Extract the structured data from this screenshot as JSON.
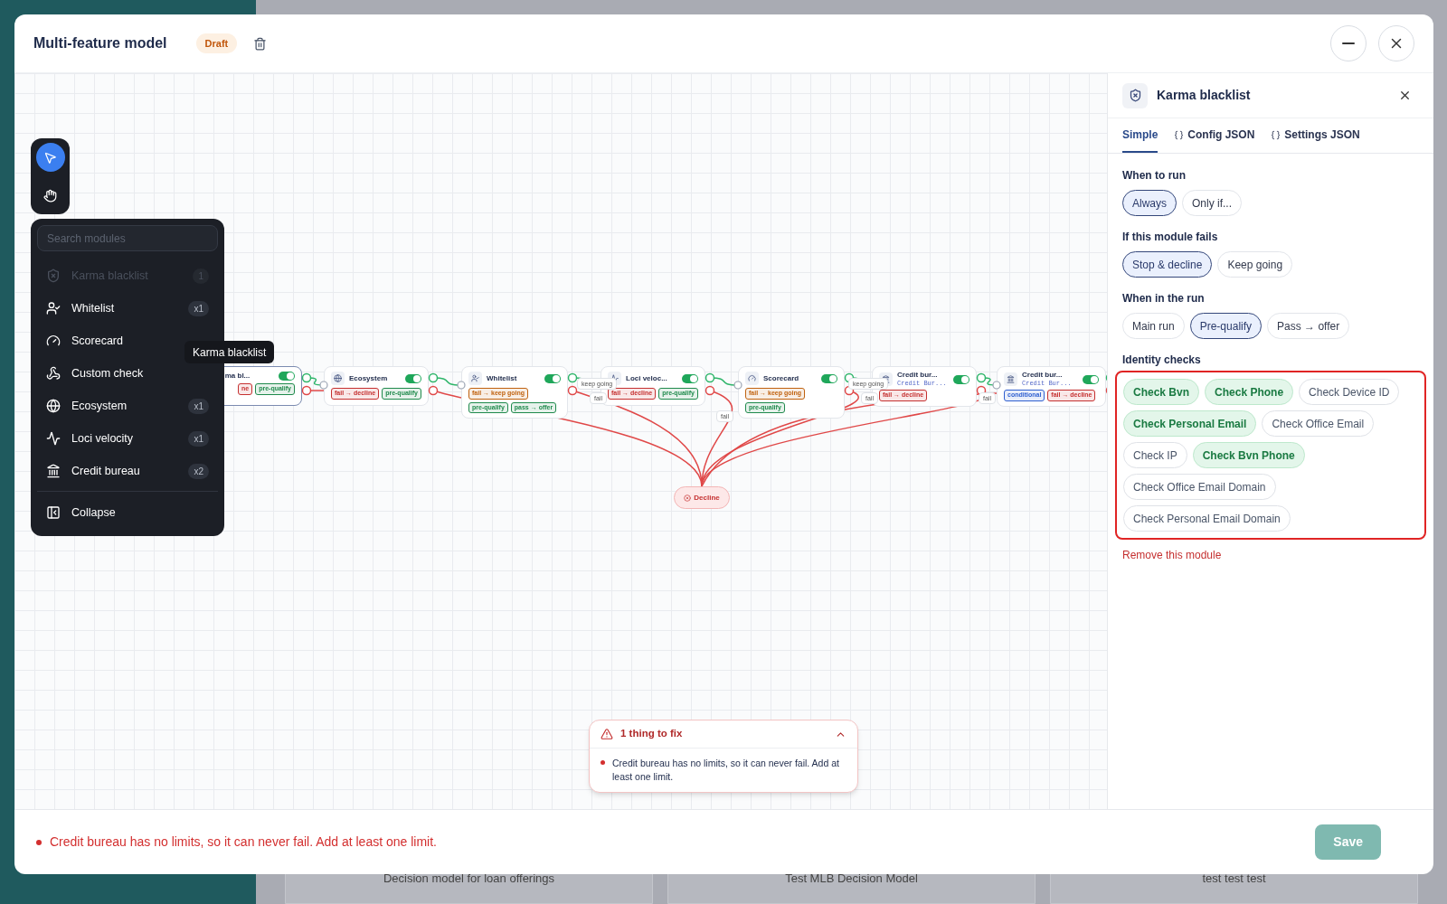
{
  "header": {
    "title": "Multi-feature model",
    "badge": "Draft"
  },
  "tools": [
    {
      "kind": "pointer",
      "selected": true
    },
    {
      "kind": "hand",
      "selected": false
    }
  ],
  "module_menu": {
    "search_placeholder": "Search modules",
    "items": [
      {
        "kind": "shield",
        "label": "Karma blacklist",
        "count": "1",
        "disabled": true
      },
      {
        "kind": "user",
        "label": "Whitelist",
        "count": "x1",
        "disabled": false
      },
      {
        "kind": "gauge",
        "label": "Scorecard",
        "disabled": false
      },
      {
        "kind": "hook",
        "label": "Custom check",
        "disabled": false
      },
      {
        "kind": "globe",
        "label": "Ecosystem",
        "count": "x1",
        "disabled": false
      },
      {
        "kind": "pulse",
        "label": "Loci velocity",
        "count": "x1",
        "disabled": false
      },
      {
        "kind": "bank",
        "label": "Credit bureau",
        "count": "x2",
        "disabled": false
      }
    ],
    "collapse": "Collapse"
  },
  "tooltip": "Karma blacklist",
  "nodes": [
    {
      "title": "ma bl...",
      "on": true,
      "tags": [
        {
          "text": "ne",
          "color": "#c53030"
        },
        {
          "text": "pre-qualify",
          "color": "#1f8a4c"
        }
      ]
    },
    {
      "kind": "globe",
      "title": "Ecosystem",
      "on": true,
      "tags": [
        {
          "text": "fail → decline",
          "color": "#c53030"
        },
        {
          "text": "pre-qualify",
          "color": "#1f8a4c"
        }
      ]
    },
    {
      "kind": "user",
      "title": "Whitelist",
      "on": true,
      "tags": [
        {
          "text": "fail → keep going",
          "color": "#c0620f"
        },
        {
          "text": "pre-qualify",
          "color": "#1f8a4c"
        },
        {
          "text": "pass → offer",
          "color": "#1f8a4c"
        }
      ]
    },
    {
      "kind": "pulse",
      "title": "Loci veloc...",
      "on": true,
      "tags": [
        {
          "text": "fail → decline",
          "color": "#c53030"
        },
        {
          "text": "pre-qualify",
          "color": "#1f8a4c"
        }
      ]
    },
    {
      "kind": "gauge",
      "title": "Scorecard",
      "on": true,
      "tags": [
        {
          "text": "fail → keep going",
          "color": "#c0620f"
        },
        {
          "text": "pre-qualify",
          "color": "#1f8a4c"
        }
      ]
    },
    {
      "kind": "bank",
      "title": "Credit bur...",
      "subtitle": "Credit Bur...",
      "on": true,
      "tags": [
        {
          "text": "fail → decline",
          "color": "#c53030"
        }
      ]
    },
    {
      "kind": "bank",
      "title": "Credit bur...",
      "subtitle": "Credit Bur...",
      "on": true,
      "tags": [
        {
          "text": "conditional",
          "color": "#2f5fd0"
        },
        {
          "text": "fail → decline",
          "color": "#c53030"
        }
      ]
    }
  ],
  "edge_labels": [
    "keep going",
    "fail",
    "fail",
    "keep going",
    "fail",
    "fail"
  ],
  "decline": "Decline",
  "issues": {
    "title": "1 thing to fix",
    "expanded": true,
    "items": [
      "Credit bureau has no limits, so it can never fail. Add at least one limit."
    ]
  },
  "inspector": {
    "title": "Karma blacklist",
    "tabs": [
      {
        "label": "Simple",
        "braces": false,
        "selected": true
      },
      {
        "label": "Config JSON",
        "braces": true,
        "selected": false
      },
      {
        "label": "Settings JSON",
        "braces": true,
        "selected": false
      }
    ],
    "sections": [
      {
        "kind": "choice",
        "label": "When to run",
        "options": [
          {
            "label": "Always",
            "selected": true
          },
          {
            "label": "Only if...",
            "selected": false
          }
        ]
      },
      {
        "kind": "choice",
        "label": "If this module fails",
        "options": [
          {
            "label": "Stop & decline",
            "selected": true
          },
          {
            "label": "Keep going",
            "selected": false
          }
        ]
      },
      {
        "kind": "choice",
        "label": "When in the run",
        "options": [
          {
            "label": "Main run",
            "selected": false
          },
          {
            "label": "Pre-qualify",
            "selected": true
          },
          {
            "label": "Pass → offer",
            "selected": false
          }
        ]
      },
      {
        "kind": "checks",
        "label": "Identity checks",
        "highlighted": true,
        "options": [
          {
            "label": "Check Bvn",
            "selected": true
          },
          {
            "label": "Check Phone",
            "selected": true
          },
          {
            "label": "Check Device ID",
            "selected": false
          },
          {
            "label": "Check Personal Email",
            "selected": true
          },
          {
            "label": "Check Office Email",
            "selected": false
          },
          {
            "label": "Check IP",
            "selected": false
          },
          {
            "label": "Check Bvn Phone",
            "selected": true
          },
          {
            "label": "Check Office Email Domain",
            "selected": false
          },
          {
            "label": "Check Personal Email Domain",
            "selected": false
          }
        ]
      }
    ],
    "remove": "Remove this module"
  },
  "footer": {
    "error": "Credit bureau has no limits, so it can never fail. Add at least one limit.",
    "save": "Save"
  },
  "background_cards": [
    "Decision model for loan offerings",
    "Test MLB Decision Model",
    "test test test"
  ]
}
